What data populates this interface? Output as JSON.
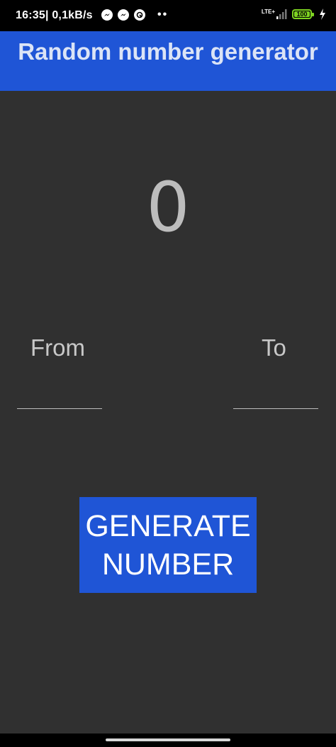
{
  "status_bar": {
    "time": "16:35",
    "network_speed": "| 0,1kB/s",
    "icons": [
      "messenger-icon",
      "messenger-icon",
      "at-sign-icon"
    ],
    "more": "••",
    "network_label": "LTE+",
    "battery_level": "100"
  },
  "app_bar": {
    "title": "Random number generator"
  },
  "main": {
    "result": "0",
    "from_label": "From",
    "to_label": "To",
    "from_value": "",
    "to_value": "",
    "generate_line1": "GENERATE",
    "generate_line2": "NUMBER"
  },
  "colors": {
    "accent": "#1f55d6",
    "background": "#303030",
    "battery": "#7ed321"
  }
}
